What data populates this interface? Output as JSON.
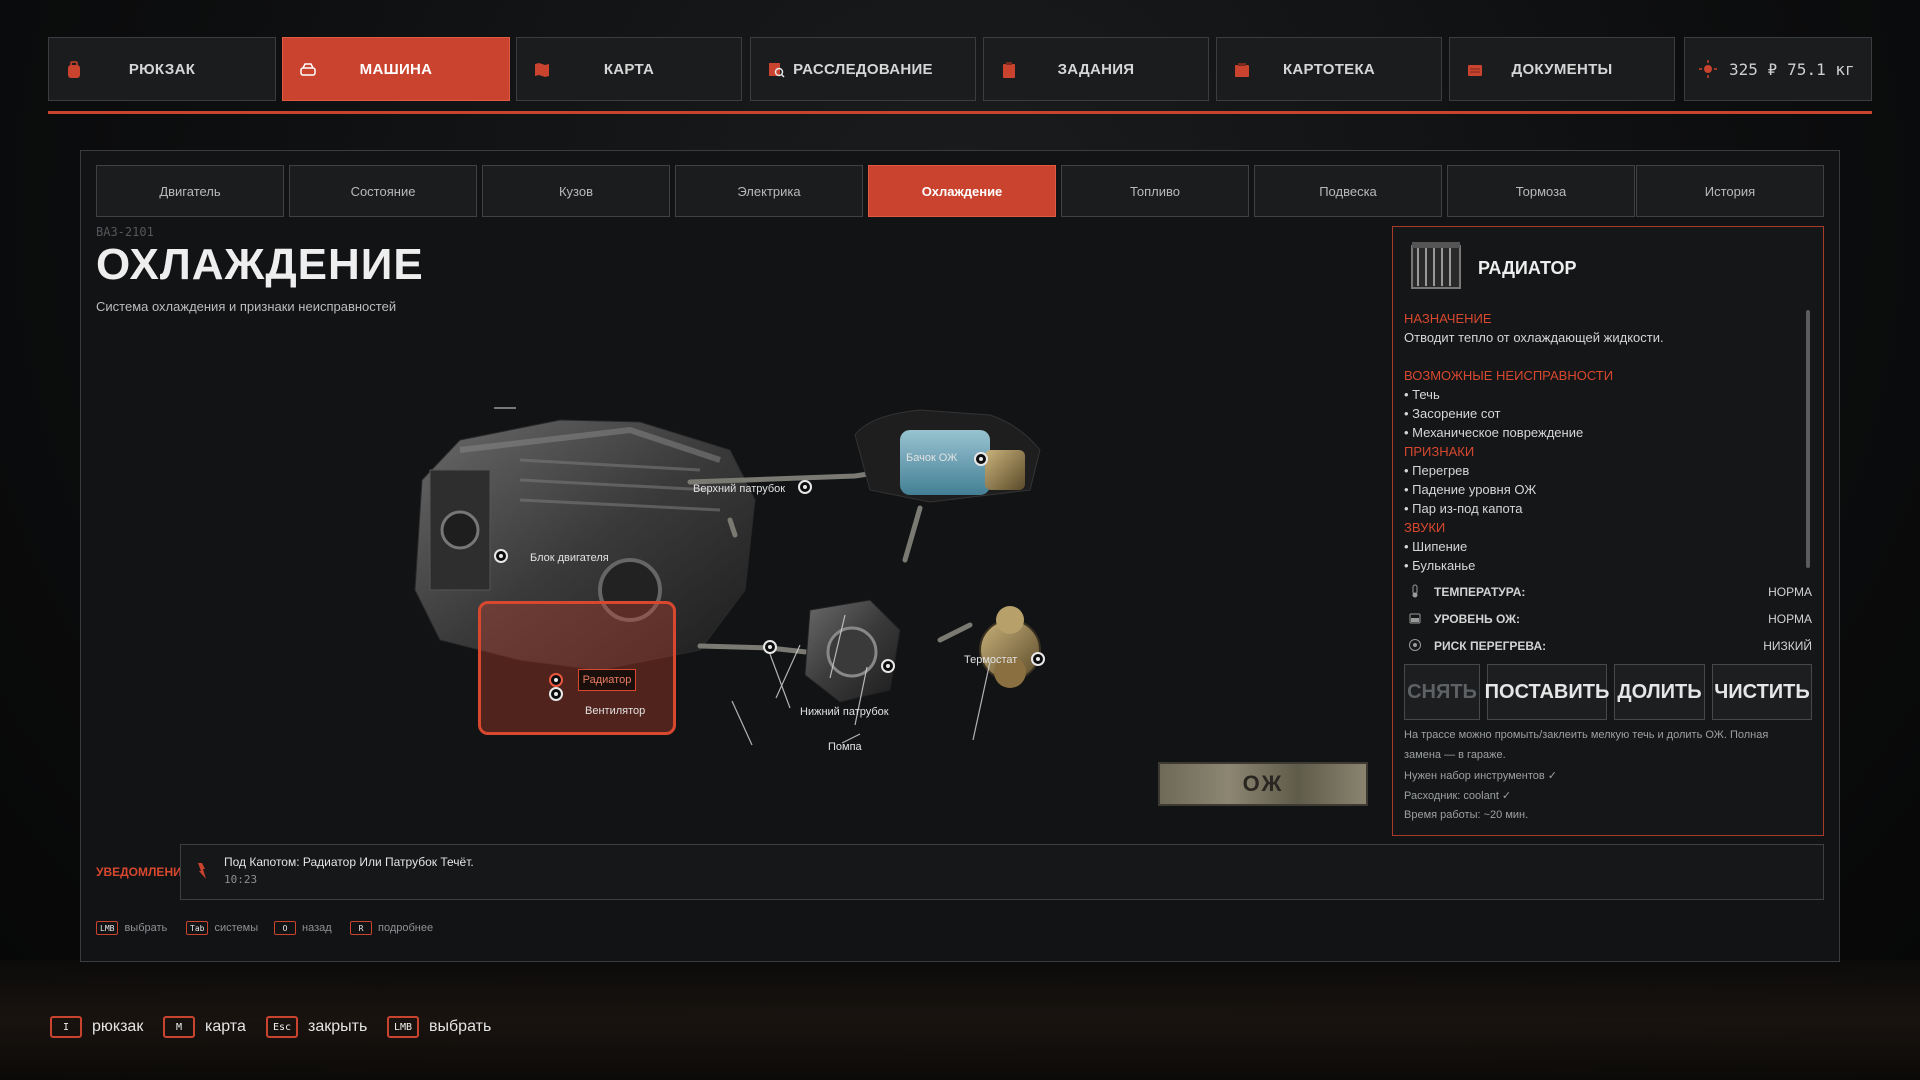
{
  "nav": {
    "tabs": [
      {
        "label": "РЮКЗАК",
        "icon": "backpack-icon"
      },
      {
        "label": "МАШИНА",
        "icon": "car-icon",
        "active": true
      },
      {
        "label": "КАРТА",
        "icon": "map-icon"
      },
      {
        "label": "РАССЛЕДОВАНИЕ",
        "icon": "investigation-icon"
      },
      {
        "label": "ЗАДАНИЯ",
        "icon": "clipboard-icon"
      },
      {
        "label": "КАРТОТЕКА",
        "icon": "file-cabinet-icon"
      },
      {
        "label": "ДОКУМЕНТЫ",
        "icon": "documents-icon"
      }
    ],
    "stats": {
      "money": "325 ₽",
      "weight": "75.1 кг"
    }
  },
  "subtabs": [
    "Двигатель",
    "Состояние",
    "Кузов",
    "Электрика",
    "Охлаждение",
    "Топливо",
    "Подвеска",
    "Тормоза",
    "История"
  ],
  "active_subtab": "Охлаждение",
  "page": {
    "model": "ВАЗ-2101",
    "title": "ОХЛАЖДЕНИЕ",
    "subtitle": "Система охлаждения и признаки неисправностей"
  },
  "diagram": {
    "labels": {
      "upper_hose": "Верхний патрубок",
      "tank": "Бачок ОЖ",
      "engine_block": "Блок двигателя",
      "radiator": "Радиатор",
      "fan": "Вентилятор",
      "lower_hose": "Нижний патрубок",
      "pump": "Помпа",
      "thermostat": "Термостат"
    },
    "plate": "ОЖ"
  },
  "info": {
    "title": "РАДИАТОР",
    "purpose_heading": "НАЗНАЧЕНИЕ",
    "purpose": "Отводит тепло от охлаждающей жидкости.",
    "faults_heading": "ВОЗМОЖНЫЕ НЕИСПРАВНОСТИ",
    "faults": [
      "• Течь",
      "• Засорение сот",
      "• Механическое повреждение"
    ],
    "signs_heading": "ПРИЗНАКИ",
    "signs": [
      "• Перегрев",
      "• Падение уровня ОЖ",
      "• Пар из-под капота"
    ],
    "sounds_heading": "ЗВУКИ",
    "sounds": [
      "• Шипение",
      "• Бульканье"
    ],
    "stats": [
      {
        "label": "ТЕМПЕРАТУРА:",
        "value": "НОРМА",
        "icon": "thermometer-icon"
      },
      {
        "label": "УРОВЕНЬ ОЖ:",
        "value": "НОРМА",
        "icon": "coolant-level-icon"
      },
      {
        "label": "РИСК ПЕРЕГРЕВА:",
        "value": "НИЗКИЙ",
        "icon": "overheat-risk-icon"
      }
    ],
    "actions": [
      {
        "label": "СНЯТЬ",
        "disabled": true
      },
      {
        "label": "ПОСТАВИТЬ"
      },
      {
        "label": "ДОЛИТЬ"
      },
      {
        "label": "ЧИСТИТЬ"
      }
    ],
    "notes": [
      "На трассе можно промыть/заклеить мелкую течь и долить ОЖ. Полная",
      "замена — в гараже.",
      "Нужен набор инструментов ✓",
      "Расходник: coolant ✓",
      "Время работы: ~20 мин."
    ]
  },
  "notifications": {
    "label": "УВЕДОМЛЕНИЯ",
    "text": "Под Капотом: Радиатор Или Патрубок Течёт.",
    "time": "10:23"
  },
  "hints": [
    {
      "key": "LMB",
      "label": "выбрать"
    },
    {
      "key": "Tab",
      "label": "системы"
    },
    {
      "key": "O",
      "label": "назад"
    },
    {
      "key": "R",
      "label": "подробнее"
    }
  ],
  "bottom_hints": [
    {
      "key": "I",
      "label": "рюкзак"
    },
    {
      "key": "M",
      "label": "карта"
    },
    {
      "key": "Esc",
      "label": "закрыть"
    },
    {
      "key": "LMB",
      "label": "выбрать"
    }
  ],
  "colors": {
    "accent": "#c9432e",
    "panel": "#111315",
    "background": "#0b0c0d"
  }
}
